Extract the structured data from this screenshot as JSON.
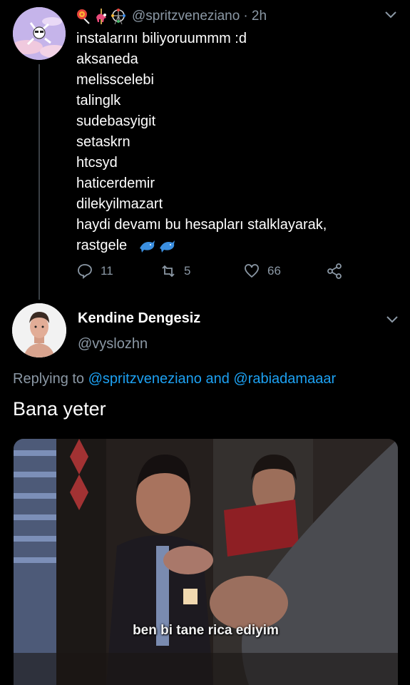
{
  "tweet1": {
    "handle": "@spritzveneziano",
    "time": "· 2h",
    "emojis": [
      "lollipop-emoji",
      "carousel-emoji",
      "ferris-wheel-emoji"
    ],
    "lines": [
      "instalarını biliyoruummm :d",
      "aksaneda",
      "melisscelebi",
      "talinglk",
      "sudebasyigit",
      "setaskrn",
      "htcsyd",
      "haticerdemir",
      "dilekyilmazart",
      "haydi devamı bu hesapları stalklayarak,",
      "rastgele"
    ],
    "trailing_emojis": [
      "dolphin-emoji",
      "dolphin-emoji"
    ],
    "replies": "11",
    "retweets": "5",
    "likes": "66"
  },
  "tweet2": {
    "name": "Kendine Dengesiz",
    "handle": "@vyslozhn",
    "replying_prefix": "Replying to",
    "mention1": "@spritzveneziano",
    "and": "and",
    "mention2": "@rabiadamaaar",
    "text": "Bana yeter",
    "media_subtitle": "ben bi tane rica ediyim"
  },
  "colors": {
    "background": "#000000",
    "secondary_text": "#8b98a5",
    "link": "#1da1f2"
  }
}
